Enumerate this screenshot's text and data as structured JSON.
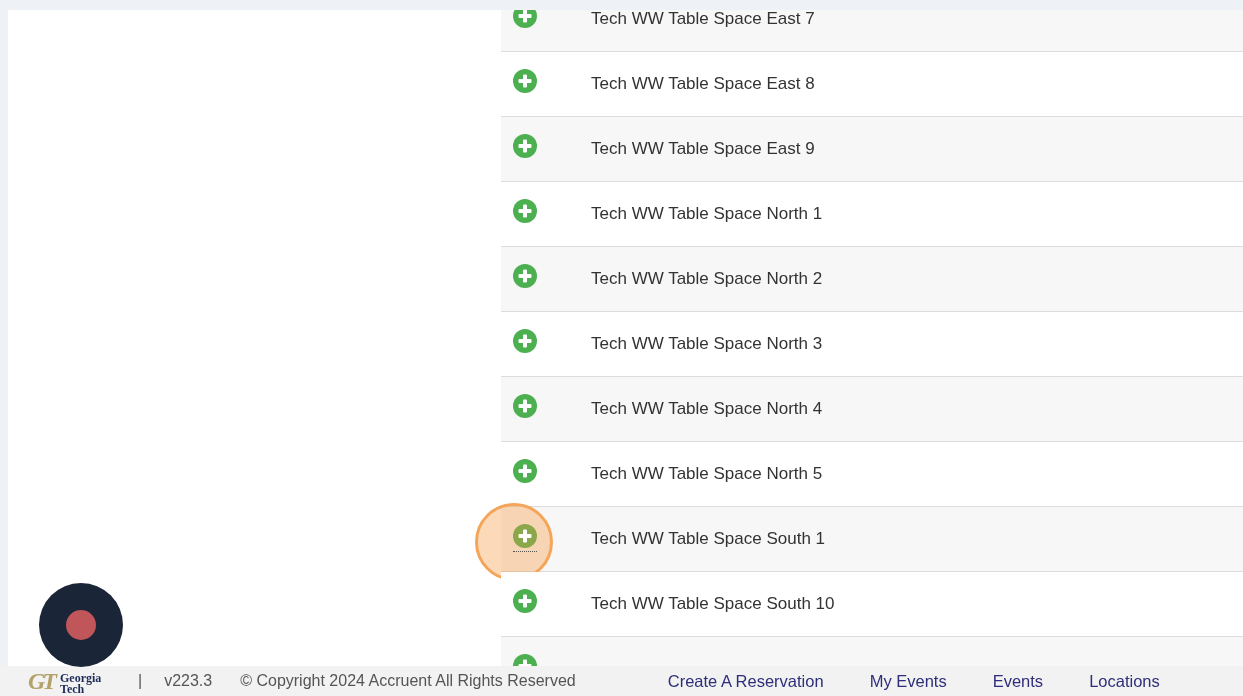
{
  "rows": [
    {
      "name": "Tech WW Table Space East 7",
      "highlighted": false
    },
    {
      "name": "Tech WW Table Space East 8",
      "highlighted": false
    },
    {
      "name": "Tech WW Table Space East 9",
      "highlighted": false
    },
    {
      "name": "Tech WW Table Space North 1",
      "highlighted": false
    },
    {
      "name": "Tech WW Table Space North 2",
      "highlighted": false
    },
    {
      "name": "Tech WW Table Space North 3",
      "highlighted": false
    },
    {
      "name": "Tech WW Table Space North 4",
      "highlighted": false
    },
    {
      "name": "Tech WW Table Space North 5",
      "highlighted": false
    },
    {
      "name": "Tech WW Table Space South 1",
      "highlighted": true
    },
    {
      "name": "Tech WW Table Space South 10",
      "highlighted": false
    },
    {
      "highlighted": false
    }
  ],
  "footer": {
    "logo_mark": "GT",
    "logo_name": "Georgia Tech",
    "separator": "|",
    "version": "v223.3",
    "copyright": "© Copyright 2024 Accruent All Rights Reserved",
    "links": [
      "Create A Reservation",
      "My Events",
      "Events",
      "Locations"
    ]
  }
}
